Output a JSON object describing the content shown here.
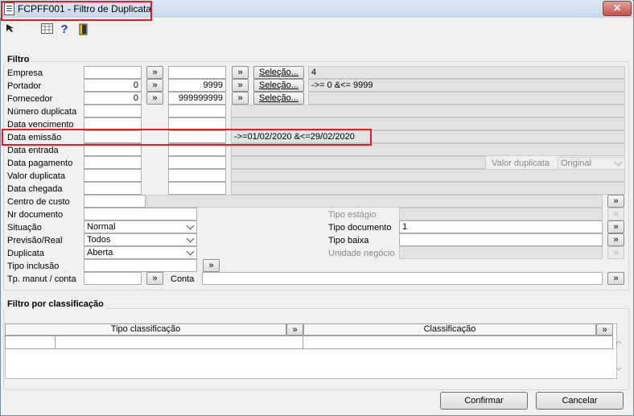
{
  "window": {
    "title": "FCPFF001 - Filtro de Duplicata",
    "close_glyph": "✕"
  },
  "toolbar": {
    "icons": [
      "pointer-icon",
      "grid-icon",
      "help-icon",
      "exit-door-icon"
    ]
  },
  "filtro": {
    "title": "Filtro",
    "rows": [
      {
        "label": "Empresa",
        "from": "",
        "to": "",
        "selecao": "Seleção...",
        "info": "4"
      },
      {
        "label": "Portador",
        "from": "0",
        "to": "9999",
        "selecao": "Seleção...",
        "info": "->= 0 &<= 9999"
      },
      {
        "label": "Fornecedor",
        "from": "0",
        "to": "999999999",
        "selecao": "Seleção...",
        "info": ""
      },
      {
        "label": "Número duplicata",
        "from": "",
        "to": "",
        "info": ""
      },
      {
        "label": "Data vencimento",
        "from": "",
        "to": "",
        "info": ""
      },
      {
        "label": "Data emissão",
        "from": "",
        "to": "",
        "info": "->=01/02/2020 &<=29/02/2020"
      },
      {
        "label": "Data entrada",
        "from": "",
        "to": "",
        "info": ""
      },
      {
        "label": "Data pagamento",
        "from": "",
        "to": "",
        "info": ""
      },
      {
        "label": "Valor duplicata",
        "from": "",
        "to": "",
        "info": ""
      },
      {
        "label": "Data chegada",
        "from": "",
        "to": "",
        "info": ""
      }
    ],
    "valor_duplicata_label": "Valor duplicata",
    "valor_duplicata_value": "Original",
    "centro_custo_label": "Centro de custo",
    "nr_documento_label": "Nr documento",
    "situacao_label": "Situação",
    "situacao_value": "Normal",
    "previsao_label": "Previsão/Real",
    "previsao_value": "Todos",
    "duplicata_label": "Duplicata",
    "duplicata_value": "Aberta",
    "tipo_inclusao_label": "Tipo inclusão",
    "tp_manut_label": "Tp. manut / conta",
    "conta_label": "Conta",
    "tipo_estagio_label": "Tipo estágio",
    "tipo_documento_label": "Tipo documento",
    "tipo_documento_value": "1",
    "tipo_baixa_label": "Tipo baixa",
    "unidade_negocio_label": "Unidade negócio",
    "arrow_glyph": "»"
  },
  "classificacao": {
    "title": "Filtro por classificação",
    "col_tipo": "Tipo classificação",
    "col_class": "Classificação"
  },
  "footer": {
    "confirmar": "Confirmar",
    "cancelar": "Cancelar"
  }
}
